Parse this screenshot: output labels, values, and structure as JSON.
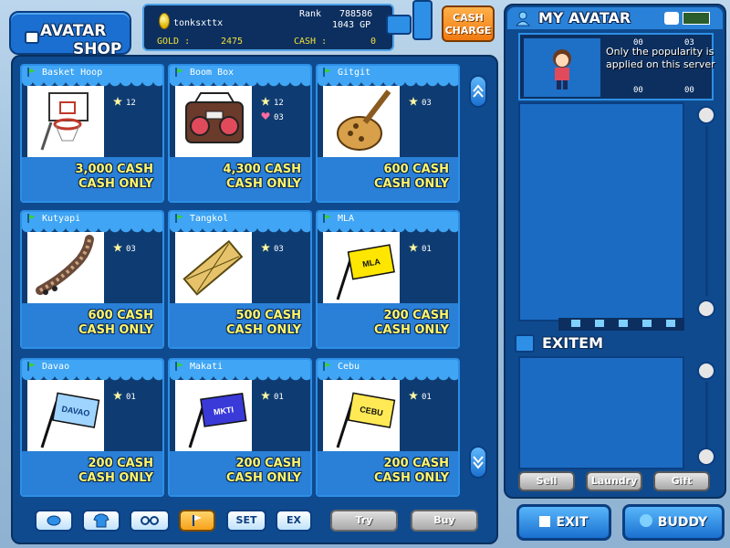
{
  "shop": {
    "title_line1": "AVATAR",
    "title_line2": "SHOP"
  },
  "player": {
    "name": "tonksxttx",
    "rank_label": "Rank",
    "rank_value": "788586",
    "gp_value": "1043 GP",
    "gold_label": "GOLD :",
    "gold_value": "2475",
    "cash_label": "CASH :",
    "cash_value": "0"
  },
  "cash_charge": {
    "line1": "CASH",
    "line2": "CHARGE"
  },
  "items": [
    {
      "name": "Basket Hoop",
      "stat1": "12",
      "stat2": "",
      "price": "3,000 CASH",
      "note": "CASH ONLY"
    },
    {
      "name": "Boom Box",
      "stat1": "12",
      "stat2": "03",
      "price": "4,300 CASH",
      "note": "CASH ONLY"
    },
    {
      "name": "Gitgit",
      "stat1": "03",
      "stat2": "",
      "price": "600 CASH",
      "note": "CASH ONLY"
    },
    {
      "name": "Kutyapi",
      "stat1": "03",
      "stat2": "",
      "price": "600 CASH",
      "note": "CASH ONLY"
    },
    {
      "name": "Tangkol",
      "stat1": "03",
      "stat2": "",
      "price": "500 CASH",
      "note": "CASH ONLY"
    },
    {
      "name": "MLA",
      "stat1": "01",
      "stat2": "",
      "price": "200 CASH",
      "note": "CASH ONLY",
      "flag_text": "MLA"
    },
    {
      "name": "Davao",
      "stat1": "01",
      "stat2": "",
      "price": "200 CASH",
      "note": "CASH ONLY",
      "flag_text": "DAVAO"
    },
    {
      "name": "Makati",
      "stat1": "01",
      "stat2": "",
      "price": "200 CASH",
      "note": "CASH ONLY",
      "flag_text": "MKTI"
    },
    {
      "name": "Cebu",
      "stat1": "01",
      "stat2": "",
      "price": "200 CASH",
      "note": "CASH ONLY",
      "flag_text": "CEBU"
    }
  ],
  "bottom_buttons": {
    "set": "SET",
    "ex": "EX",
    "try": "Try",
    "buy": "Buy"
  },
  "avatar_panel": {
    "title": "MY AVATAR",
    "notice": "Only the popularity is applied on this server",
    "stats": [
      "00",
      "03",
      "00",
      "00"
    ],
    "exitem_title": "EXITEM",
    "sell": "Sell",
    "laundry": "Laundry",
    "gift": "Gift"
  },
  "footer": {
    "exit": "EXIT",
    "buddy": "BUDDY"
  },
  "colors": {
    "panel": "#0f4a8e",
    "accent": "#2d8fe6",
    "price": "#fff56a",
    "charge": "#f07a10"
  }
}
